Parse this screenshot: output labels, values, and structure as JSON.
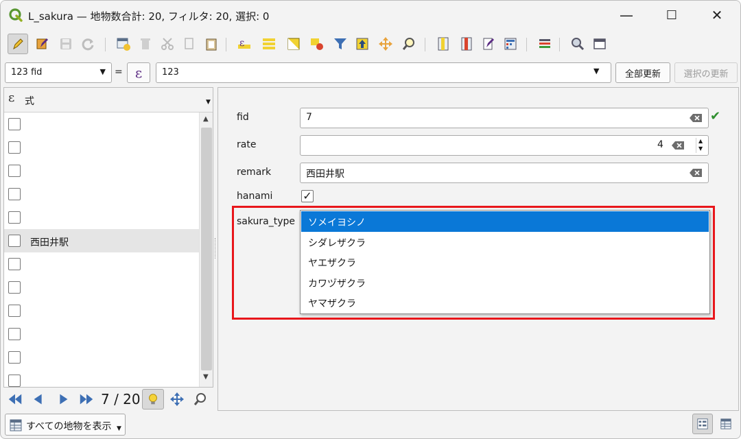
{
  "window": {
    "title": "L_sakura — 地物数合計: 20, フィルタ: 20, 選択: 0",
    "minimize": "—",
    "maximize": "☐",
    "close": "✕"
  },
  "expression_bar": {
    "field_value": "123 fid",
    "equals": "=",
    "epsilon": "ε",
    "expression_value": "123",
    "update_all_label": "全部更新",
    "update_selected_label": "選択の更新"
  },
  "list": {
    "header_epsilon": "ε",
    "header_label": "式",
    "rows": [
      {
        "label": ""
      },
      {
        "label": ""
      },
      {
        "label": ""
      },
      {
        "label": ""
      },
      {
        "label": ""
      },
      {
        "label": "西田井駅"
      },
      {
        "label": ""
      },
      {
        "label": ""
      },
      {
        "label": ""
      },
      {
        "label": ""
      },
      {
        "label": ""
      },
      {
        "label": ""
      }
    ],
    "selected_index": 5
  },
  "navigation": {
    "counter": "7 / 20"
  },
  "bottom": {
    "show_all_label": "すべての地物を表示"
  },
  "form": {
    "fid_label": "fid",
    "fid_value": "7",
    "rate_label": "rate",
    "rate_value": "4",
    "remark_label": "remark",
    "remark_value": "西田井駅",
    "hanami_label": "hanami",
    "hanami_checked": "✓",
    "sakura_type_label": "sakura_type",
    "sakura_type_options": [
      "ソメイヨシノ",
      "シダレザクラ",
      "ヤエザクラ",
      "カワヅザクラ",
      "ヤマザクラ"
    ],
    "sakura_type_selected": 0
  },
  "colors": {
    "accent": "#0a78d7",
    "highlight": "#e8161b",
    "valid": "#2f8f2f"
  }
}
